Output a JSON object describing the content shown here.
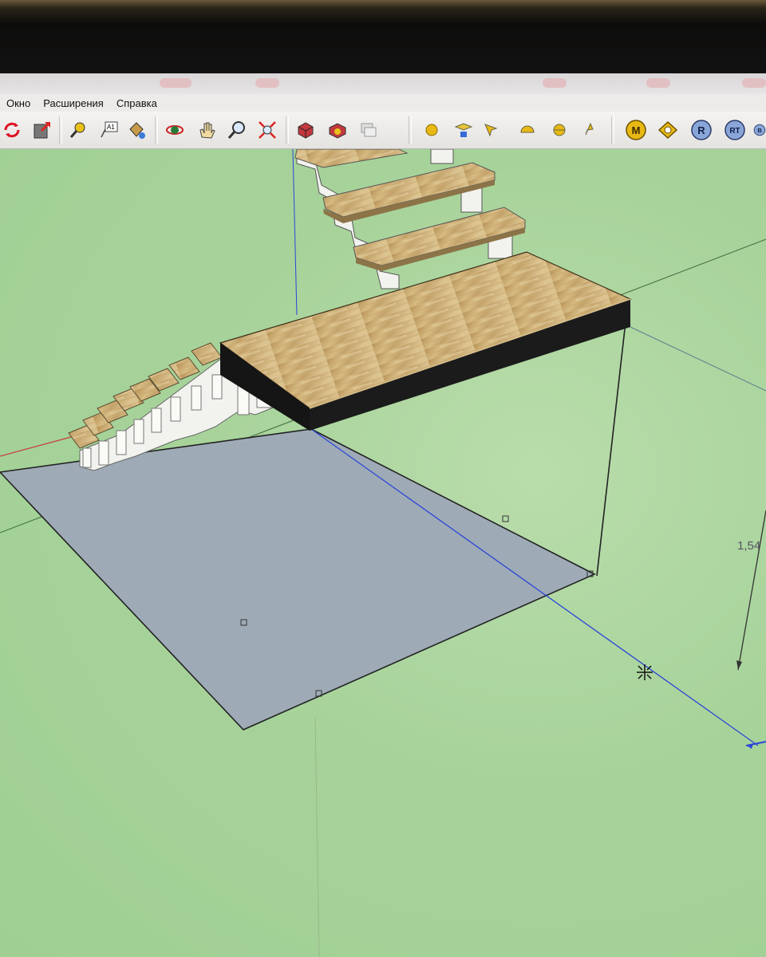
{
  "menu": {
    "items": [
      "Окно",
      "Расширения",
      "Справка"
    ]
  },
  "toolbar": {
    "tools": [
      "refresh-icon",
      "export-icon",
      "tape-measure-icon",
      "text-label-icon",
      "paint-bucket-icon",
      "orbit-icon",
      "pan-icon",
      "zoom-icon",
      "zoom-extents-icon",
      "component-icon",
      "materials-icon",
      "layers-icon",
      "sun-icon",
      "section-plane-icon",
      "arrow-icon",
      "half-sphere-icon",
      "sphere-icon",
      "cursor-icon",
      "render-m-icon",
      "render-settings-icon",
      "render-r-icon",
      "render-rt-icon",
      "render-b-icon"
    ],
    "render_buttons": [
      "M",
      "R",
      "RT",
      "B"
    ]
  },
  "canvas": {
    "dimension_label": "1,54",
    "colors": {
      "background": "#a8d49b",
      "floor_rect": "#9eabb6",
      "tread_wood": "#c8aa74",
      "stringer": "#f2f2ee",
      "axis_blue": "#2b45d8",
      "axis_green": "#3c8a3c",
      "axis_red": "#c84040"
    }
  }
}
